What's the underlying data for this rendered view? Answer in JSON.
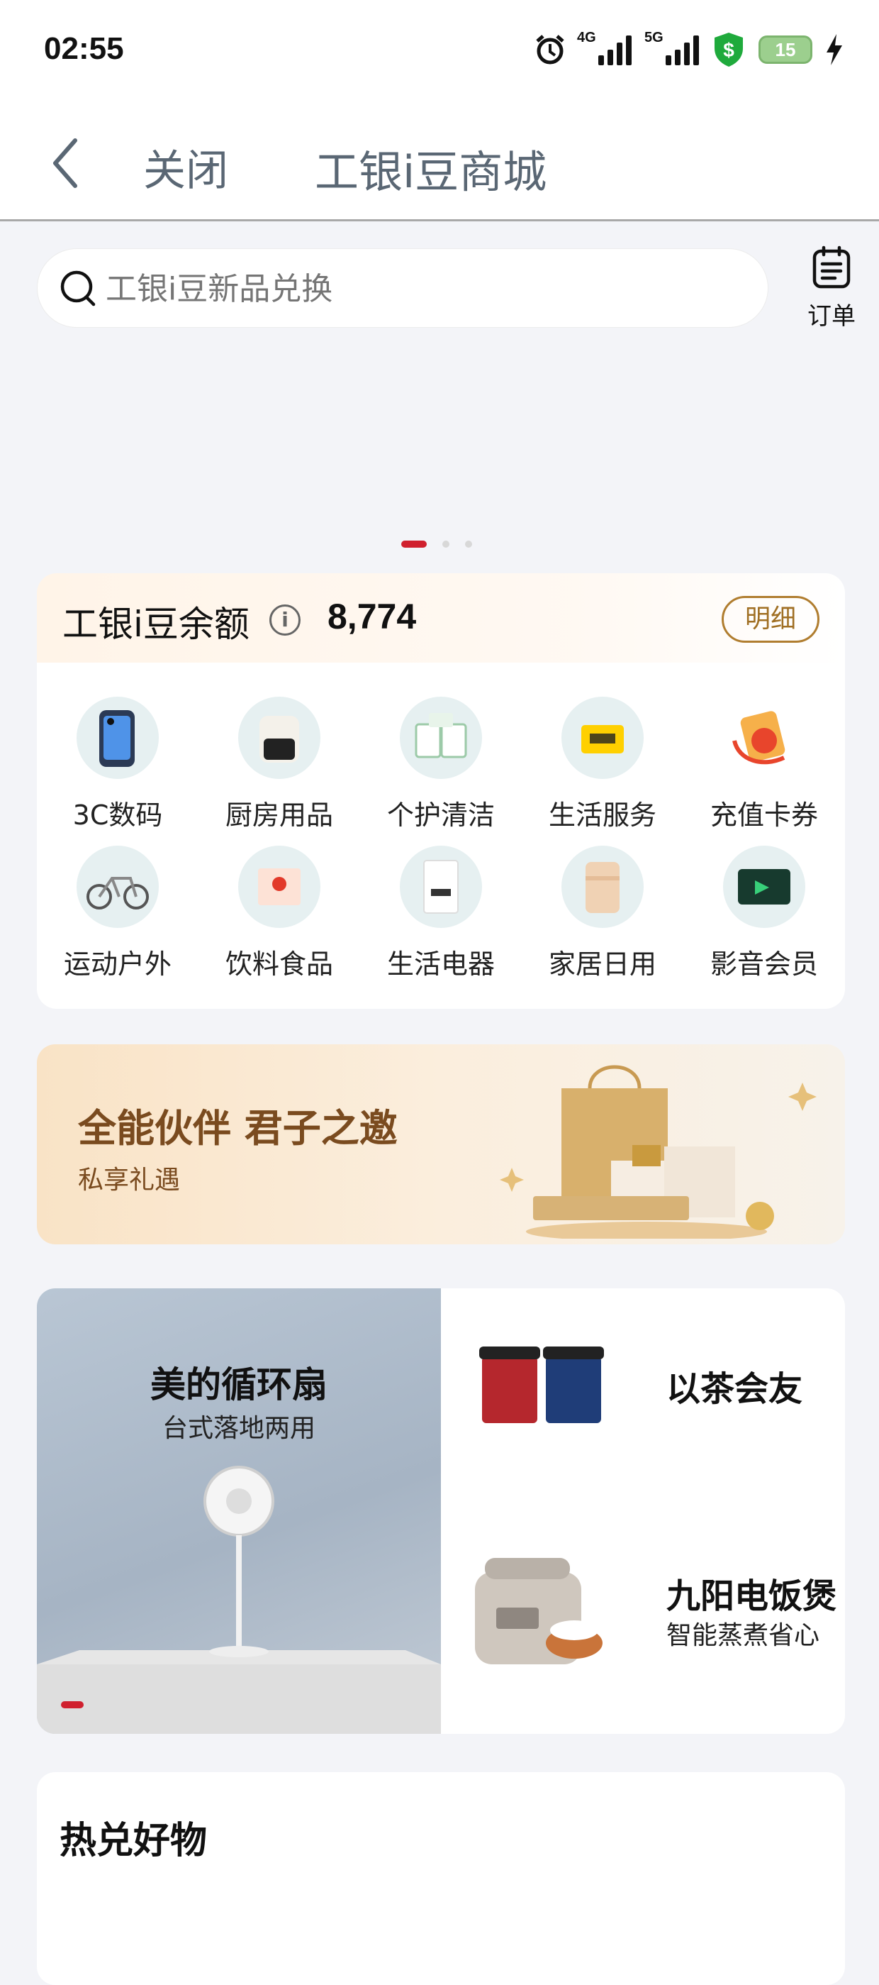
{
  "status_bar": {
    "time": "02:55",
    "battery": "15",
    "network_a": "4G",
    "network_b": "5G"
  },
  "nav": {
    "close_label": "关闭",
    "title": "工银i豆商城"
  },
  "search": {
    "placeholder": "工银i豆新品兑换",
    "orders_label": "订单"
  },
  "balance": {
    "label": "工银i豆余额",
    "value": "8,774",
    "detail_label": "明细",
    "info_icon": "info-icon"
  },
  "categories": [
    {
      "label": "3C数码"
    },
    {
      "label": "厨房用品"
    },
    {
      "label": "个护清洁"
    },
    {
      "label": "生活服务"
    },
    {
      "label": "充值卡券"
    },
    {
      "label": "运动户外"
    },
    {
      "label": "饮料食品"
    },
    {
      "label": "生活电器"
    },
    {
      "label": "家居日用"
    },
    {
      "label": "影音会员"
    }
  ],
  "promo": {
    "headline": "全能伙伴 君子之邀",
    "sub": "私享礼遇"
  },
  "featured": {
    "main": {
      "title": "美的循环扇",
      "subtitle": "台式落地两用"
    },
    "side": [
      {
        "title": "以茶会友",
        "subtitle": ""
      },
      {
        "title": "九阳电饭煲",
        "subtitle": "智能蒸煮省心"
      }
    ]
  },
  "hot": {
    "title": "热兑好物"
  },
  "colors": {
    "accent": "#d0202e",
    "gold": "#a06f23",
    "nav_text": "#5a6774"
  }
}
